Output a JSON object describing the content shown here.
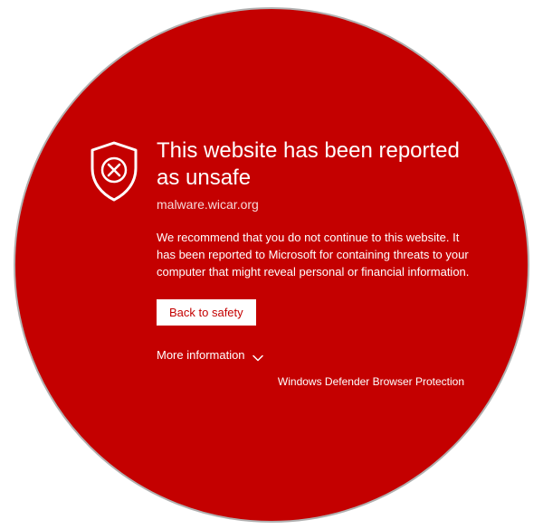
{
  "warning": {
    "title": "This website has been reported as unsafe",
    "hostname": "malware.wicar.org",
    "description": "We recommend that you do not continue to this website. It has been reported to Microsoft for containing threats to your computer that might reveal personal or financial information.",
    "back_button_label": "Back to safety",
    "more_info_label": "More information"
  },
  "footer": {
    "product_name": "Windows Defender Browser Protection"
  },
  "colors": {
    "background": "#c40000",
    "text": "#ffffff",
    "button_bg": "#ffffff",
    "button_text": "#c40000"
  }
}
